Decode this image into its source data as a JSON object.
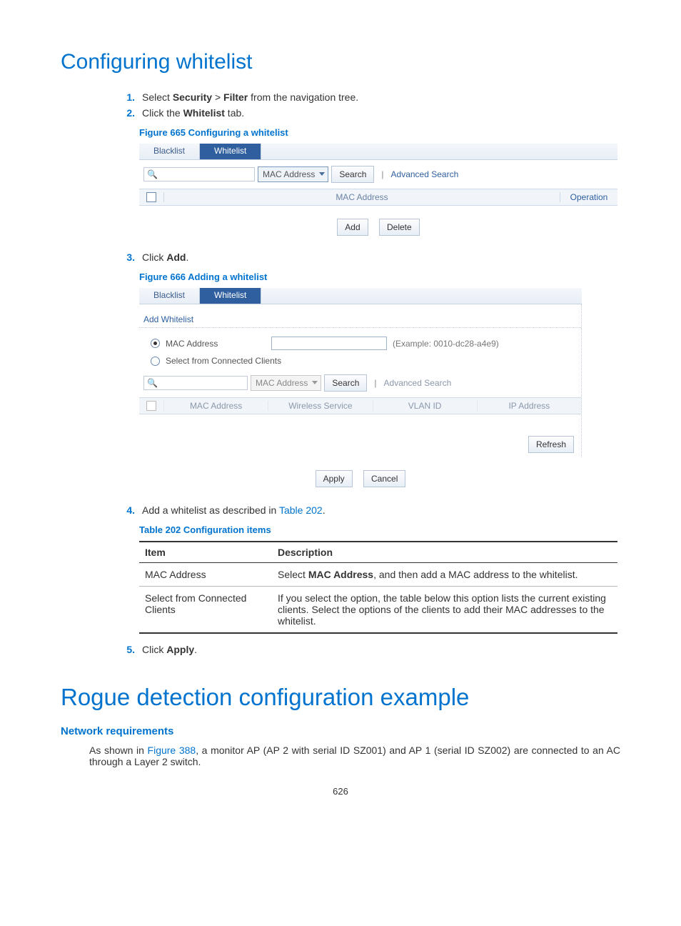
{
  "h1": "Configuring whitelist",
  "steps12": {
    "s1_num": "1.",
    "s1_pre": "Select ",
    "s1_b1": "Security",
    "s1_mid": " > ",
    "s1_b2": "Filter",
    "s1_post": " from the navigation tree.",
    "s2_num": "2.",
    "s2_pre": "Click the ",
    "s2_b": "Whitelist",
    "s2_post": " tab."
  },
  "fig665": {
    "caption": "Figure 665 Configuring a whitelist",
    "tab_blacklist": "Blacklist",
    "tab_whitelist": "Whitelist",
    "select_macaddr": "MAC Address",
    "btn_search": "Search",
    "link_advsearch": "Advanced Search",
    "col_mac": "MAC Address",
    "col_op": "Operation",
    "btn_add": "Add",
    "btn_delete": "Delete"
  },
  "step3": {
    "num": "3.",
    "pre": "Click ",
    "b": "Add",
    "post": "."
  },
  "fig666": {
    "caption": "Figure 666 Adding a whitelist",
    "tab_blacklist": "Blacklist",
    "tab_whitelist": "Whitelist",
    "subtitle": "Add Whitelist",
    "radio_mac": "MAC Address",
    "mac_example": "(Example: 0010-dc28-a4e9)",
    "radio_clients": "Select from Connected Clients",
    "select_macaddr": "MAC Address",
    "btn_search": "Search",
    "link_advsearch": "Advanced Search",
    "col_mac": "MAC Address",
    "col_ws": "Wireless Service",
    "col_vlan": "VLAN ID",
    "col_ip": "IP Address",
    "btn_refresh": "Refresh",
    "btn_apply": "Apply",
    "btn_cancel": "Cancel"
  },
  "step4": {
    "num": "4.",
    "pre": "Add a whitelist as described in ",
    "link": "Table 202",
    "post": "."
  },
  "table202": {
    "caption": "Table 202 Configuration items",
    "h_item": "Item",
    "h_desc": "Description",
    "r1_item": "MAC Address",
    "r1_desc_pre": "Select ",
    "r1_desc_b": "MAC Address",
    "r1_desc_post": ", and then add a MAC address to the whitelist.",
    "r2_item": "Select from Connected Clients",
    "r2_desc": "If you select the option, the table below this option lists the current existing clients. Select the options of the clients to add their MAC addresses to the whitelist."
  },
  "step5": {
    "num": "5.",
    "pre": "Click ",
    "b": "Apply",
    "post": "."
  },
  "h1b": "Rogue detection configuration example",
  "h3_netreq": "Network requirements",
  "netreq": {
    "pre": "As shown in ",
    "link": "Figure 388",
    "post": ", a monitor AP (AP 2 with serial ID SZ001) and AP 1 (serial ID SZ002) are connected to an AC through a Layer 2 switch."
  },
  "pagenum": "626"
}
